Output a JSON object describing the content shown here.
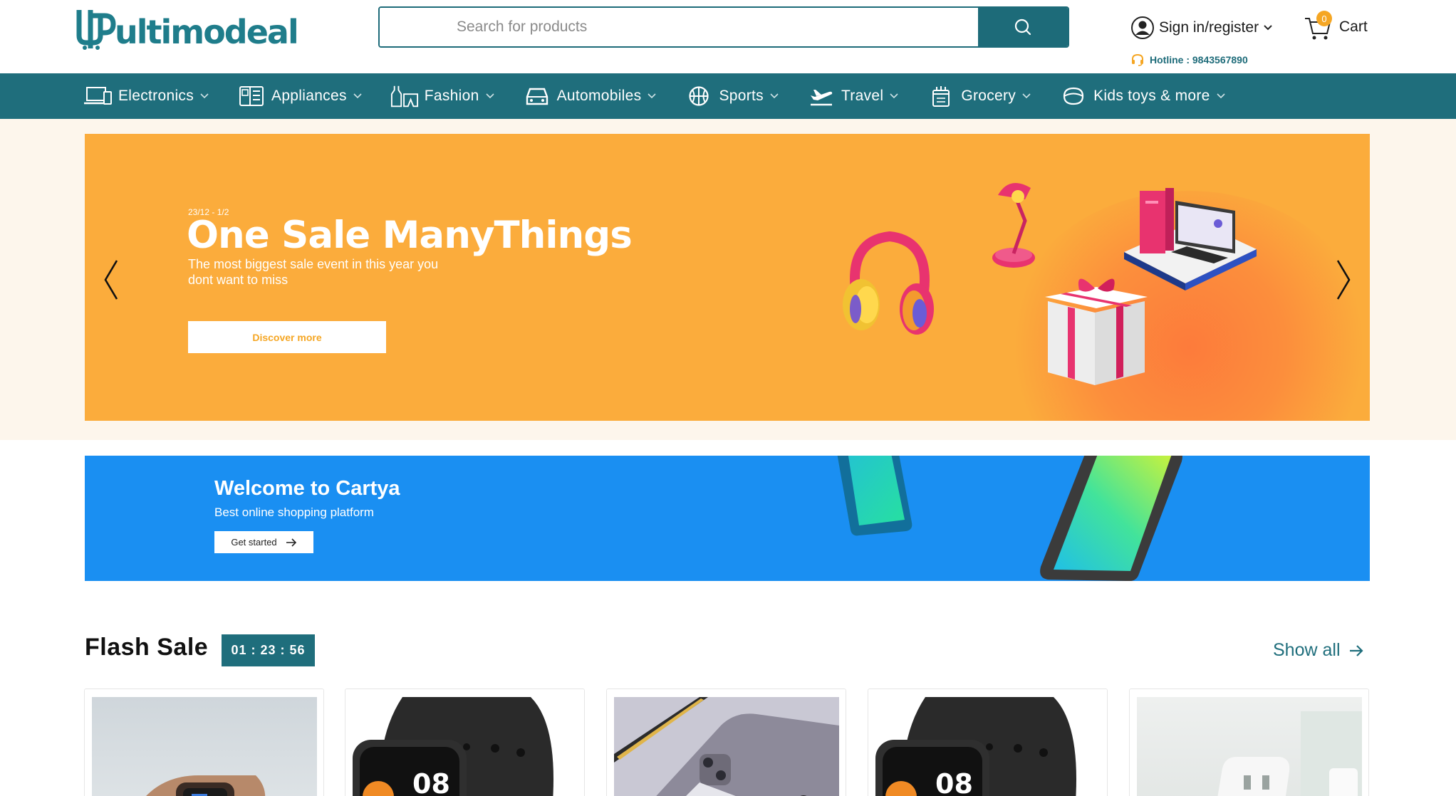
{
  "header": {
    "logo_text": "ultimodeal",
    "search": {
      "placeholder": "Search for products",
      "value": ""
    },
    "signin_label": "Sign in/register",
    "cart": {
      "label": "Cart",
      "count": "0"
    },
    "hotline": "Hotline : 9843567890"
  },
  "nav": {
    "items": [
      {
        "label": "Electronics",
        "icon": "devices-icon"
      },
      {
        "label": "Appliances",
        "icon": "appliance-icon"
      },
      {
        "label": "Fashion",
        "icon": "fashion-icon"
      },
      {
        "label": "Automobiles",
        "icon": "car-icon"
      },
      {
        "label": "Sports",
        "icon": "basketball-icon"
      },
      {
        "label": "Travel",
        "icon": "airplane-icon"
      },
      {
        "label": "Grocery",
        "icon": "grocery-icon"
      },
      {
        "label": "Kids toys & more",
        "icon": "toy-icon"
      }
    ]
  },
  "hero": {
    "date": "23/12 - 1/2",
    "title": "One Sale ManyThings",
    "subtitle": "The most biggest sale event in this year you dont want to miss",
    "button": "Discover more"
  },
  "welcome": {
    "title": "Welcome to Cartya",
    "subtitle": "Best online shopping platform",
    "button": "Get started"
  },
  "flash_sale": {
    "title": "Flash Sale",
    "timer": "01 : 23 : 56",
    "show_all": "Show all",
    "products": [
      {
        "image": "apple-watch-wrist-photo"
      },
      {
        "image": "black-smartwatch-photo",
        "display_text": "08"
      },
      {
        "image": "ipad-pro-photo"
      },
      {
        "image": "black-smartwatch-photo",
        "display_text": "08"
      },
      {
        "image": "white-charger-photo"
      }
    ]
  },
  "colors": {
    "brand_teal": "#1f6e7c",
    "hero_orange": "#fbac3c",
    "welcome_blue": "#1a8ff2",
    "badge_orange": "#f5a623"
  }
}
